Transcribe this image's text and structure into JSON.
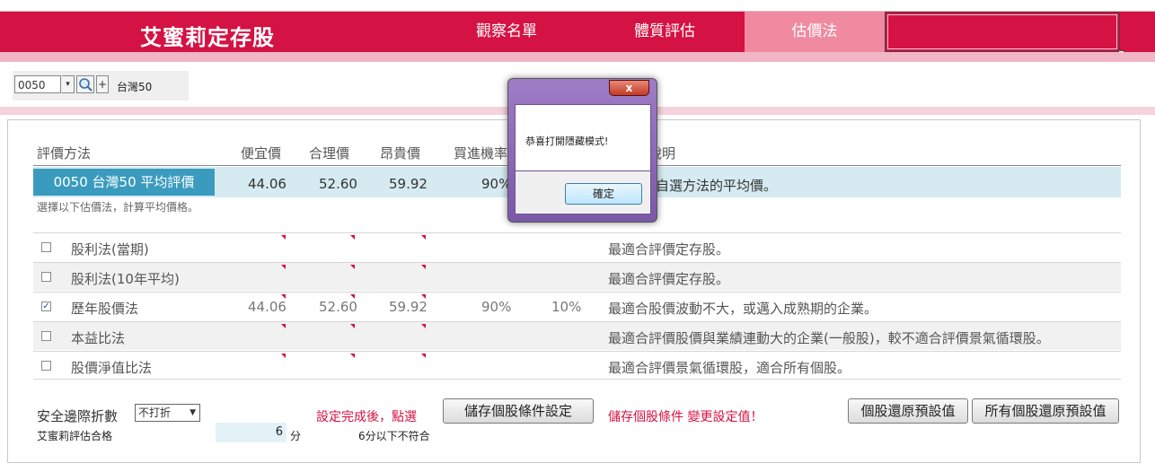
{
  "header": {
    "brand": "艾蜜莉定存股",
    "nav": [
      {
        "label": "觀察名單",
        "active": false
      },
      {
        "label": "體質評估",
        "active": false
      },
      {
        "label": "估價法",
        "active": true
      }
    ]
  },
  "stock_selector": {
    "code": "0050",
    "name": "台灣50"
  },
  "table": {
    "headers": [
      "評價方法",
      "便宜價",
      "合理價",
      "昂貴價",
      "買進機率",
      "說明"
    ],
    "average_row": {
      "label": "0050 台灣50  平均評價",
      "cheap": "44.06",
      "fair": "52.60",
      "expensive": "59.92",
      "buy_prob": "90%",
      "description": "依照自選方法的平均價。"
    },
    "hint": "選擇以下估價法，計算平均價格。",
    "rows": [
      {
        "name": "股利法(當期)",
        "checked": false,
        "cheap": "",
        "fair": "",
        "expensive": "",
        "buy_prob": "",
        "sell_prob": "",
        "description": "最適合評價定存股。"
      },
      {
        "name": "股利法(10年平均)",
        "checked": false,
        "cheap": "",
        "fair": "",
        "expensive": "",
        "buy_prob": "",
        "sell_prob": "",
        "description": "最適合評價定存股。"
      },
      {
        "name": "歷年股價法",
        "checked": true,
        "cheap": "44.06",
        "fair": "52.60",
        "expensive": "59.92",
        "buy_prob": "90%",
        "sell_prob": "10%",
        "description": "最適合股價波動不大，或邁入成熟期的企業。"
      },
      {
        "name": "本益比法",
        "checked": false,
        "cheap": "",
        "fair": "",
        "expensive": "",
        "buy_prob": "",
        "sell_prob": "",
        "description": "最適合評價股價與業績連動大的企業(一般股)，較不適合評價景氣循環股。"
      },
      {
        "name": "股價淨值比法",
        "checked": false,
        "cheap": "",
        "fair": "",
        "expensive": "",
        "buy_prob": "",
        "sell_prob": "",
        "description": "最適合評價景氣循環股，適合所有個股。"
      }
    ]
  },
  "footer": {
    "discount_label": "安全邊際折數",
    "discount_value": "不打折",
    "note_before_save": "設定完成後，點選",
    "save_button": "儲存個股條件設定",
    "note_after_save": "儲存個股條件 變更設定值！",
    "reset_stock_button": "個股還原預設值",
    "reset_all_button": "所有個股還原預設值",
    "pass_label": "艾蜜莉評估合格",
    "score": "6",
    "score_unit": "分",
    "fail_note": "6分以下不符合"
  },
  "dialog": {
    "close_label": "x",
    "message": "恭喜打開隱藏模式!",
    "ok_button": "確定"
  }
}
